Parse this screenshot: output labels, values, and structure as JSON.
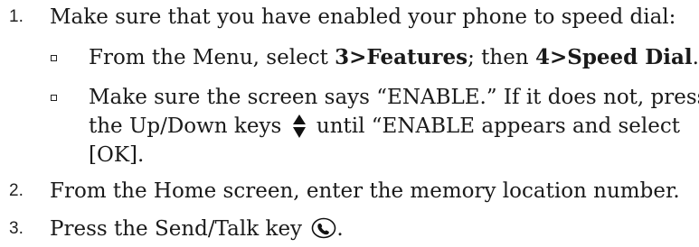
{
  "steps": [
    {
      "number": "1.",
      "text": "Make sure that you have enabled your phone to speed dial:"
    },
    {
      "number": "2.",
      "text": "From the Home screen, enter the memory location number."
    },
    {
      "number": "3.",
      "text_before": "Press the Send/Talk key",
      "text_after": "."
    }
  ],
  "substeps": [
    {
      "part1": "From the Menu, select ",
      "bold1": "3>Features",
      "part2": "; then ",
      "bold2": "4>Speed Dial",
      "part3": "."
    },
    {
      "line1": "Make sure the screen says “ENABLE.” If it does not, press",
      "line2_before": "the Up/Down keys",
      "line2_after": "until “ENABLE appears and select",
      "line3": "[OK]."
    }
  ],
  "icons": {
    "updown": "up-down-arrow-icon",
    "send": "send-talk-key-icon"
  }
}
